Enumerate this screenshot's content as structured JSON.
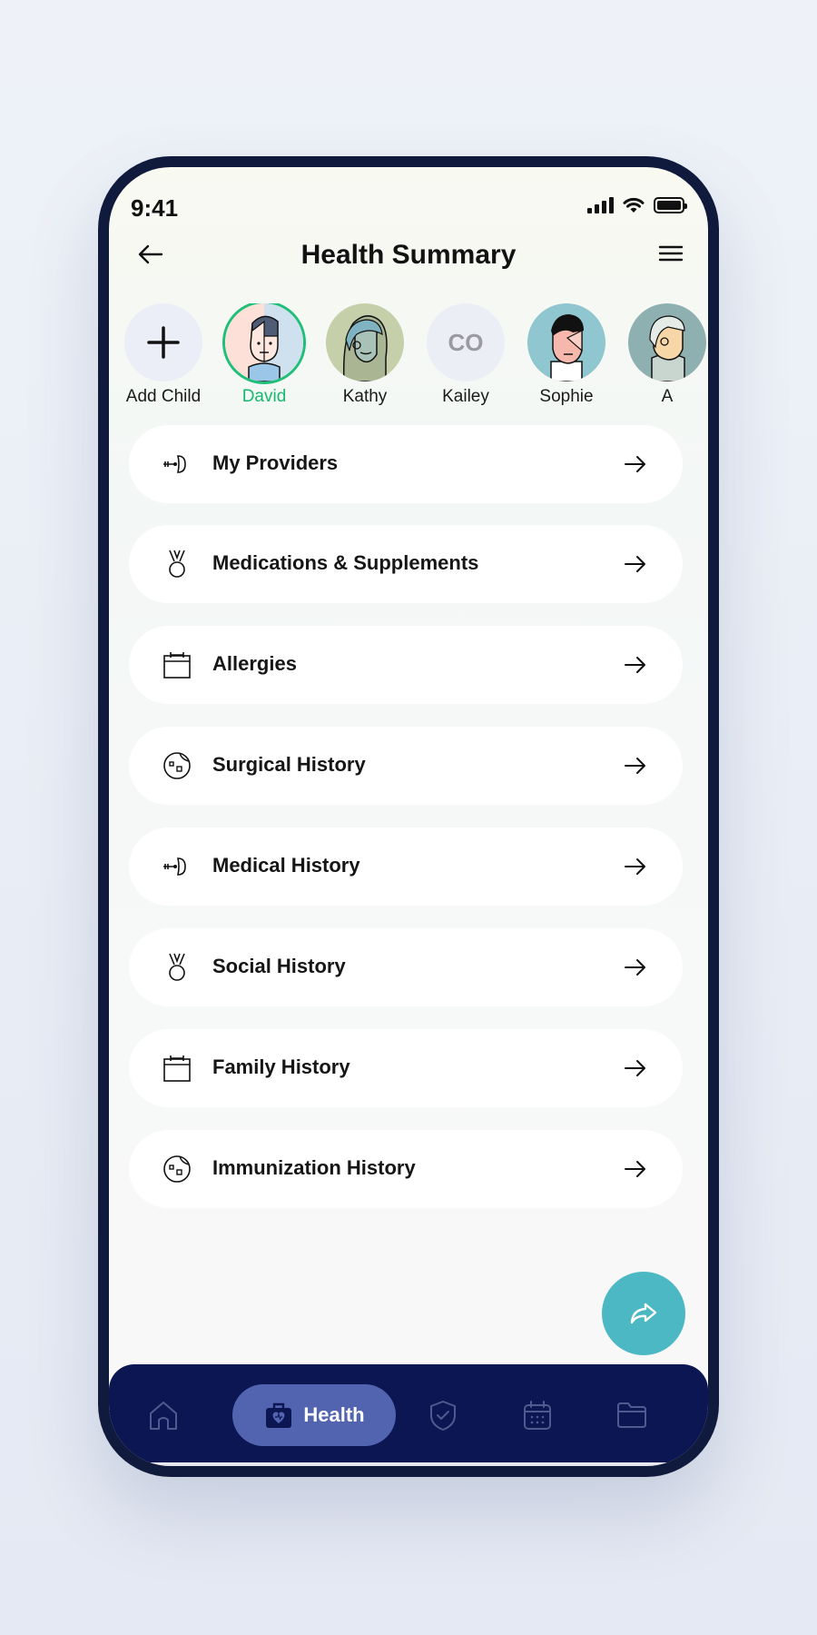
{
  "status_bar": {
    "time": "9:41"
  },
  "header": {
    "title": "Health Summary"
  },
  "profiles": [
    {
      "name": "Add Child",
      "type": "add"
    },
    {
      "name": "David",
      "type": "avatar",
      "active": true
    },
    {
      "name": "Kathy",
      "type": "avatar"
    },
    {
      "name": "Kailey",
      "type": "initials",
      "initials": "CO"
    },
    {
      "name": "Sophie",
      "type": "avatar"
    },
    {
      "name": "A",
      "type": "avatar"
    }
  ],
  "menu": [
    {
      "label": "My Providers",
      "icon": "stethoscope-icon"
    },
    {
      "label": "Medications & Supplements",
      "icon": "medal-icon"
    },
    {
      "label": "Allergies",
      "icon": "calendar-icon"
    },
    {
      "label": "Surgical History",
      "icon": "cell-icon"
    },
    {
      "label": "Medical History",
      "icon": "stethoscope-icon"
    },
    {
      "label": "Social History",
      "icon": "medal-icon"
    },
    {
      "label": "Family History",
      "icon": "calendar-icon"
    },
    {
      "label": "Immunization History",
      "icon": "cell-icon"
    }
  ],
  "bottom_nav": {
    "items": [
      {
        "icon": "home-icon"
      },
      {
        "icon": "health-bag-icon",
        "label": "Health",
        "active": true
      },
      {
        "icon": "shield-icon"
      },
      {
        "icon": "calendar-icon"
      },
      {
        "icon": "folder-icon"
      }
    ]
  },
  "colors": {
    "accent_green": "#17b86f",
    "nav_bg": "#0b1652",
    "nav_active": "#5264b0",
    "fab": "#4bb8c4"
  }
}
